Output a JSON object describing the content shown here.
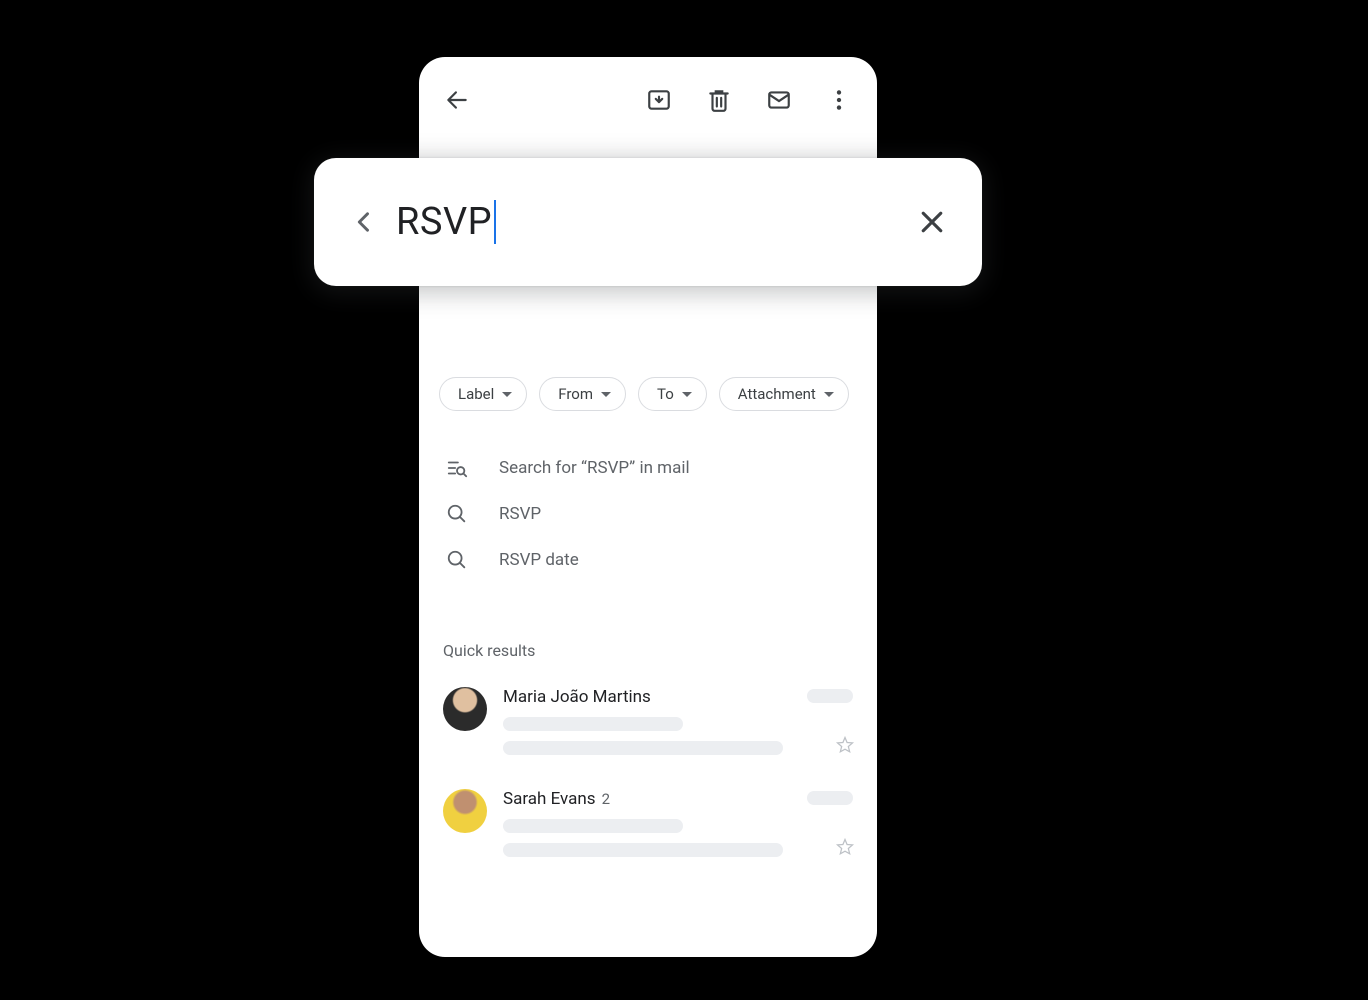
{
  "search": {
    "query": "RSVP"
  },
  "chips": [
    {
      "label": "Label"
    },
    {
      "label": "From"
    },
    {
      "label": "To"
    },
    {
      "label": "Attachment"
    }
  ],
  "suggestions": {
    "search_in_mail": "Search for “RSVP” in mail",
    "items": [
      "RSVP",
      "RSVP date"
    ]
  },
  "quick_results": {
    "header": "Quick results",
    "items": [
      {
        "name": "Maria João Martins",
        "count": ""
      },
      {
        "name": "Sarah Evans",
        "count": "2"
      }
    ]
  }
}
